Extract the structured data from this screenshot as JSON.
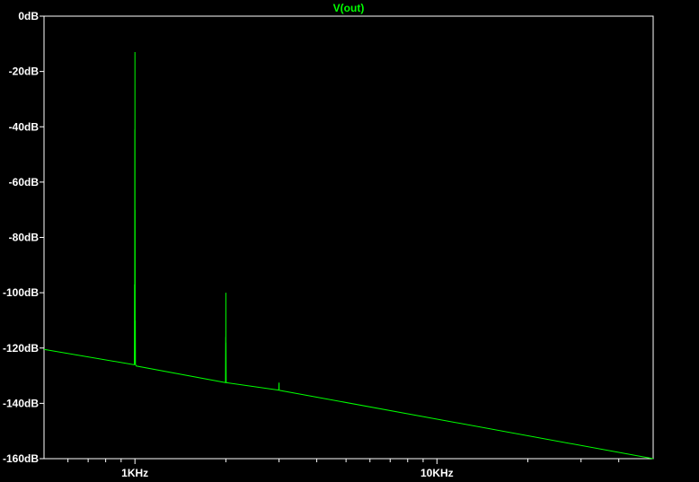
{
  "chart_data": {
    "type": "line",
    "title": "V(out)",
    "xlabel": "",
    "ylabel": "",
    "x_scale": "log",
    "xlim": [
      500,
      52000
    ],
    "ylim": [
      -160,
      0
    ],
    "y_ticks": [
      0,
      -20,
      -40,
      -60,
      -80,
      -100,
      -120,
      -140,
      -160
    ],
    "y_tick_labels": [
      "0dB",
      "-20dB",
      "-40dB",
      "-60dB",
      "-80dB",
      "-100dB",
      "-120dB",
      "-140dB",
      "-160dB"
    ],
    "x_major_ticks": [
      1000,
      10000
    ],
    "x_tick_labels": [
      "1KHz",
      "10KHz"
    ],
    "x_minor_ticks": [
      600,
      700,
      800,
      900,
      2000,
      3000,
      4000,
      5000,
      6000,
      7000,
      8000,
      9000,
      20000,
      30000,
      40000
    ],
    "grid": false,
    "colors": {
      "background": "#000000",
      "trace": "#00ff00",
      "axis": "#ffffff",
      "title": "#00ff00"
    },
    "series": [
      {
        "name": "V(out)",
        "x": [
          500,
          990,
          995,
          996,
          997,
          998,
          999,
          999.5,
          1000,
          1000.5,
          1001,
          1002,
          1003,
          1004,
          1005,
          1010,
          1995,
          1998,
          1999,
          2000,
          2001,
          2002,
          2005,
          2990,
          2995,
          2998,
          3000,
          3002,
          3005,
          3010,
          52000
        ],
        "y": [
          -120.5,
          -126,
          -126,
          -121,
          -97,
          -126,
          -41,
          -126,
          -13,
          -126,
          -70,
          -126,
          -110,
          -126,
          -126,
          -126.5,
          -132.5,
          -116,
          -132.5,
          -100,
          -132.5,
          -118,
          -132.5,
          -135.2,
          -135.2,
          -133,
          -132.5,
          -135.2,
          -135.2,
          -135.3,
          -160
        ]
      }
    ]
  }
}
